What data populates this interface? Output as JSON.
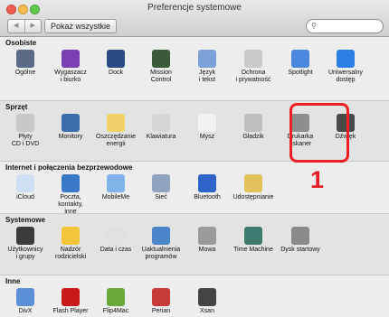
{
  "window": {
    "title": "Preferencje systemowe"
  },
  "toolbar": {
    "back": "◀",
    "forward": "▶",
    "show_all": "Pokaż wszystkie",
    "search_placeholder": "",
    "search_icon": "magnifier-icon"
  },
  "sections": [
    {
      "title": "Osobiste",
      "items": [
        {
          "l1": "Ogólne",
          "l2": "",
          "icon": "general-icon",
          "color": "#5b6b86"
        },
        {
          "l1": "Wygaszacz",
          "l2": "i biurko",
          "icon": "desktop-icon",
          "color": "#7a3fb3"
        },
        {
          "l1": "Dock",
          "l2": "",
          "icon": "dock-icon",
          "color": "#2b4b86"
        },
        {
          "l1": "Mission",
          "l2": "Control",
          "icon": "mission-control-icon",
          "color": "#3a5a3a"
        },
        {
          "l1": "Język",
          "l2": "i tekst",
          "icon": "language-icon",
          "color": "#7da1d8"
        },
        {
          "l1": "Ochrona",
          "l2": "i prywatność",
          "icon": "security-icon",
          "color": "#c9c9c9"
        },
        {
          "l1": "Spotlight",
          "l2": "",
          "icon": "spotlight-icon",
          "color": "#4a88de"
        },
        {
          "l1": "Uniwersalny",
          "l2": "dostęp",
          "icon": "accessibility-icon",
          "color": "#2a7fe6"
        }
      ]
    },
    {
      "title": "Sprzęt",
      "items": [
        {
          "l1": "Płyty",
          "l2": "CD i DVD",
          "icon": "cd-icon",
          "color": "#c8c8c8"
        },
        {
          "l1": "Monitory",
          "l2": "",
          "icon": "monitor-icon",
          "color": "#3a6ea8"
        },
        {
          "l1": "Oszczędzanie",
          "l2": "energii",
          "icon": "energy-bulb-icon",
          "color": "#f1d26a"
        },
        {
          "l1": "Klawiatura",
          "l2": "",
          "icon": "keyboard-icon",
          "color": "#d6d6d6"
        },
        {
          "l1": "Mysz",
          "l2": "",
          "icon": "mouse-icon",
          "color": "#f2f2f2"
        },
        {
          "l1": "Gładzik",
          "l2": "",
          "icon": "trackpad-icon",
          "color": "#bdbdbd"
        },
        {
          "l1": "Drukarka",
          "l2": "i skaner",
          "icon": "printer-icon",
          "color": "#8d8d8d"
        },
        {
          "l1": "Dźwięk",
          "l2": "",
          "icon": "speaker-icon",
          "color": "#4a4a4a"
        }
      ]
    },
    {
      "title": "Internet i połączenia bezprzewodowe",
      "items": [
        {
          "l1": "iCloud",
          "l2": "",
          "icon": "icloud-icon",
          "color": "#cfdff3"
        },
        {
          "l1": "Poczta, kontakty,",
          "l2": "inne",
          "icon": "mail-icon",
          "color": "#3a78c8"
        },
        {
          "l1": "MobileMe",
          "l2": "",
          "icon": "mobileme-icon",
          "color": "#7fb3ea"
        },
        {
          "l1": "Sieć",
          "l2": "",
          "icon": "network-icon",
          "color": "#8fa3bf"
        },
        {
          "l1": "Bluetooth",
          "l2": "",
          "icon": "bluetooth-icon",
          "color": "#2e63c9"
        },
        {
          "l1": "Udostępnianie",
          "l2": "",
          "icon": "sharing-icon",
          "color": "#e2c35a"
        }
      ]
    },
    {
      "title": "Systemowe",
      "items": [
        {
          "l1": "Użytkownicy",
          "l2": "i grupy",
          "icon": "users-icon",
          "color": "#3b3b3b"
        },
        {
          "l1": "Nadzór",
          "l2": "rodzicielski",
          "icon": "parental-controls-icon",
          "color": "#f3c63a"
        },
        {
          "l1": "Data i czas",
          "l2": "",
          "icon": "date-time-icon",
          "color": "#e0e0e0"
        },
        {
          "l1": "Uaktualnienia",
          "l2": "programów",
          "icon": "software-update-icon",
          "color": "#4b84c9"
        },
        {
          "l1": "Mowa",
          "l2": "",
          "icon": "microphone-icon",
          "color": "#9a9a9a"
        },
        {
          "l1": "Time Machine",
          "l2": "",
          "icon": "time-machine-icon",
          "color": "#3f7c6f"
        },
        {
          "l1": "Dysk startowy",
          "l2": "",
          "icon": "startup-disk-icon",
          "color": "#8a8a8a"
        }
      ]
    },
    {
      "title": "Inne",
      "items": [
        {
          "l1": "DivX",
          "l2": "",
          "icon": "divx-icon",
          "color": "#5b8fd6"
        },
        {
          "l1": "Flash Player",
          "l2": "",
          "icon": "flash-icon",
          "color": "#c81a1a"
        },
        {
          "l1": "Flip4Mac",
          "l2": "",
          "icon": "flip4mac-icon",
          "color": "#6aa83a"
        },
        {
          "l1": "Perian",
          "l2": "",
          "icon": "perian-icon",
          "color": "#c83a3a"
        },
        {
          "l1": "Xsan",
          "l2": "",
          "icon": "xsan-icon",
          "color": "#444444"
        }
      ]
    }
  ],
  "annotation": {
    "step_number": "1"
  }
}
